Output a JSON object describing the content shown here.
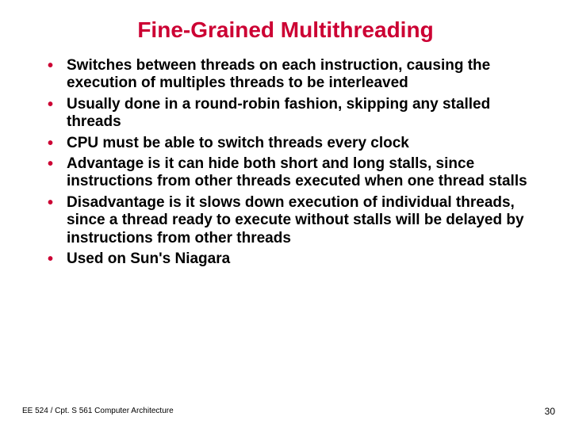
{
  "title": "Fine-Grained Multithreading",
  "bullets": [
    "Switches between threads on each instruction, causing the execution of multiples threads to be interleaved",
    "Usually done in a round-robin fashion, skipping any stalled threads",
    "CPU must be able to switch threads every clock",
    "Advantage is it can hide both short and long stalls, since instructions from other threads executed when one thread stalls",
    "Disadvantage is it slows down execution of individual threads, since a thread ready to execute without stalls will be delayed by instructions from other threads",
    "Used on Sun's Niagara"
  ],
  "footer": {
    "course": "EE 524 / Cpt. S 561 Computer Architecture",
    "page": "30"
  }
}
